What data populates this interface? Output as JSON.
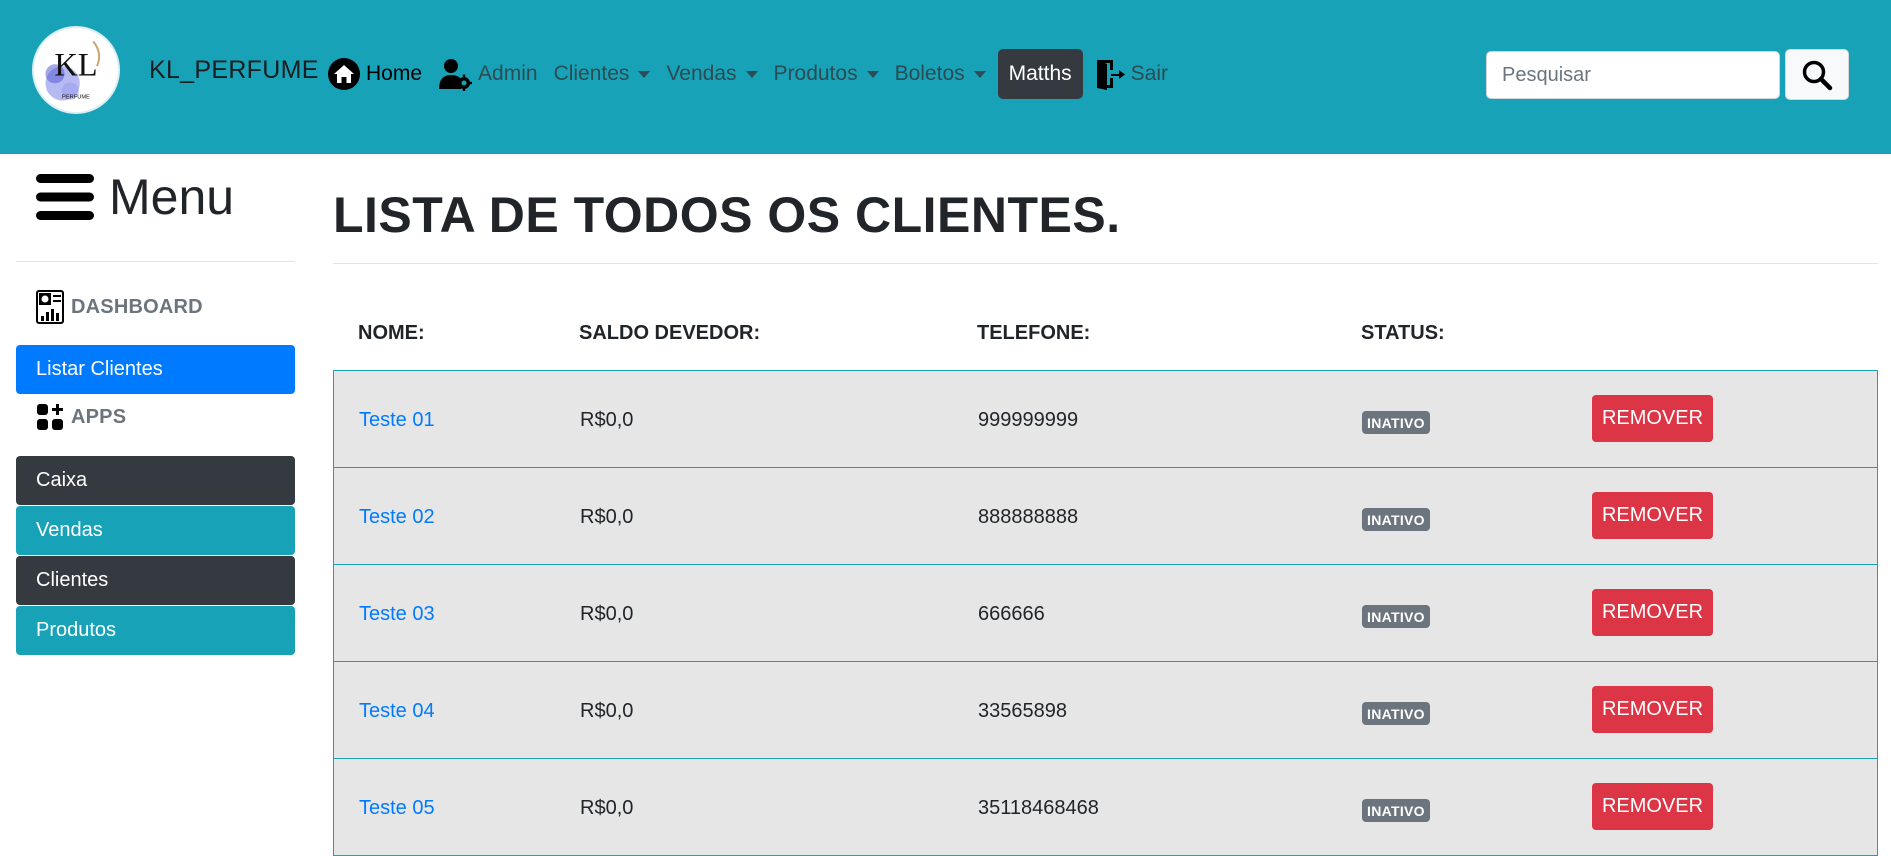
{
  "header": {
    "brand": "KL_PERFUME",
    "logo_letters": "KL",
    "logo_subtext": "PERFUME",
    "nav": [
      {
        "label": "Home",
        "icon": "home-icon"
      },
      {
        "label": "Admin",
        "icon": "admin-user-gear-icon"
      },
      {
        "label": "Clientes",
        "dropdown": true
      },
      {
        "label": "Vendas",
        "dropdown": true
      },
      {
        "label": "Produtos",
        "dropdown": true
      },
      {
        "label": "Boletos",
        "dropdown": true
      },
      {
        "label": "Matths",
        "active": true
      },
      {
        "label": "Sair",
        "icon": "logout-door-icon"
      }
    ],
    "search": {
      "placeholder": "Pesquisar",
      "value": ""
    }
  },
  "sidebar": {
    "title": "Menu",
    "dashboard_label": "DASHBOARD",
    "listar_clientes": "Listar Clientes",
    "apps_label": "APPS",
    "buttons": [
      "Caixa",
      "Vendas",
      "Clientes",
      "Produtos"
    ]
  },
  "main": {
    "title": "LISTA DE TODOS OS CLIENTES.",
    "columns": [
      "NOME:",
      "SALDO DEVEDOR:",
      "TELEFONE:",
      "STATUS:"
    ],
    "remove_label": "REMOVER",
    "rows": [
      {
        "name": "Teste 01",
        "saldo": "R$0,0",
        "telefone": "999999999",
        "status": "INATIVO"
      },
      {
        "name": "Teste 02",
        "saldo": "R$0,0",
        "telefone": "888888888",
        "status": "INATIVO"
      },
      {
        "name": "Teste 03",
        "saldo": "R$0,0",
        "telefone": "666666",
        "status": "INATIVO"
      },
      {
        "name": "Teste 04",
        "saldo": "R$0,0",
        "telefone": "33565898",
        "status": "INATIVO"
      },
      {
        "name": "Teste 05",
        "saldo": "R$0,0",
        "telefone": "35118468468",
        "status": "INATIVO"
      }
    ]
  },
  "colors": {
    "navbar": "#17a2b8",
    "primary": "#007bff",
    "dark": "#343a40",
    "danger": "#dc3545",
    "badge": "#6c757d"
  }
}
